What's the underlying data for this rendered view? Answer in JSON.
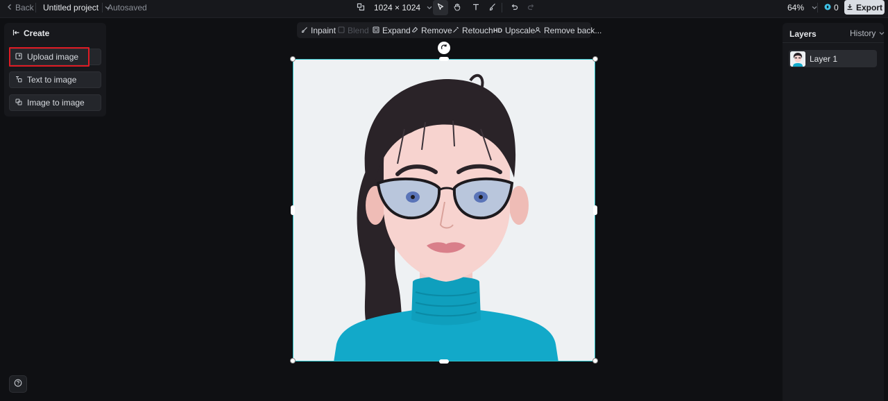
{
  "topbar": {
    "back_label": "Back",
    "project_title": "Untitled project",
    "save_status": "Autosaved",
    "canvas_size": "1024 × 1024",
    "zoom": "64%",
    "credits": "0",
    "export_label": "Export"
  },
  "left_panel": {
    "title": "Create",
    "items": [
      {
        "label": "Upload image",
        "icon": "upload-image-icon"
      },
      {
        "label": "Text to image",
        "icon": "text-to-image-icon"
      },
      {
        "label": "Image to image",
        "icon": "image-to-image-icon"
      }
    ]
  },
  "edit_toolbar": {
    "items": [
      {
        "label": "Inpaint",
        "enabled": true
      },
      {
        "label": "Blend",
        "enabled": false
      },
      {
        "label": "Expand",
        "enabled": true
      },
      {
        "label": "Remove",
        "enabled": true
      },
      {
        "label": "Retouch",
        "enabled": true
      },
      {
        "label": "Upscale",
        "badge": "HD",
        "enabled": true
      },
      {
        "label": "Remove back...",
        "enabled": true
      }
    ]
  },
  "right_panel": {
    "title": "Layers",
    "history_label": "History",
    "layers": [
      {
        "name": "Layer 1"
      }
    ]
  },
  "colors": {
    "accent": "#2fc7cd",
    "highlight": "#e01b24",
    "background": "#0f1013",
    "panel": "#17181c"
  }
}
